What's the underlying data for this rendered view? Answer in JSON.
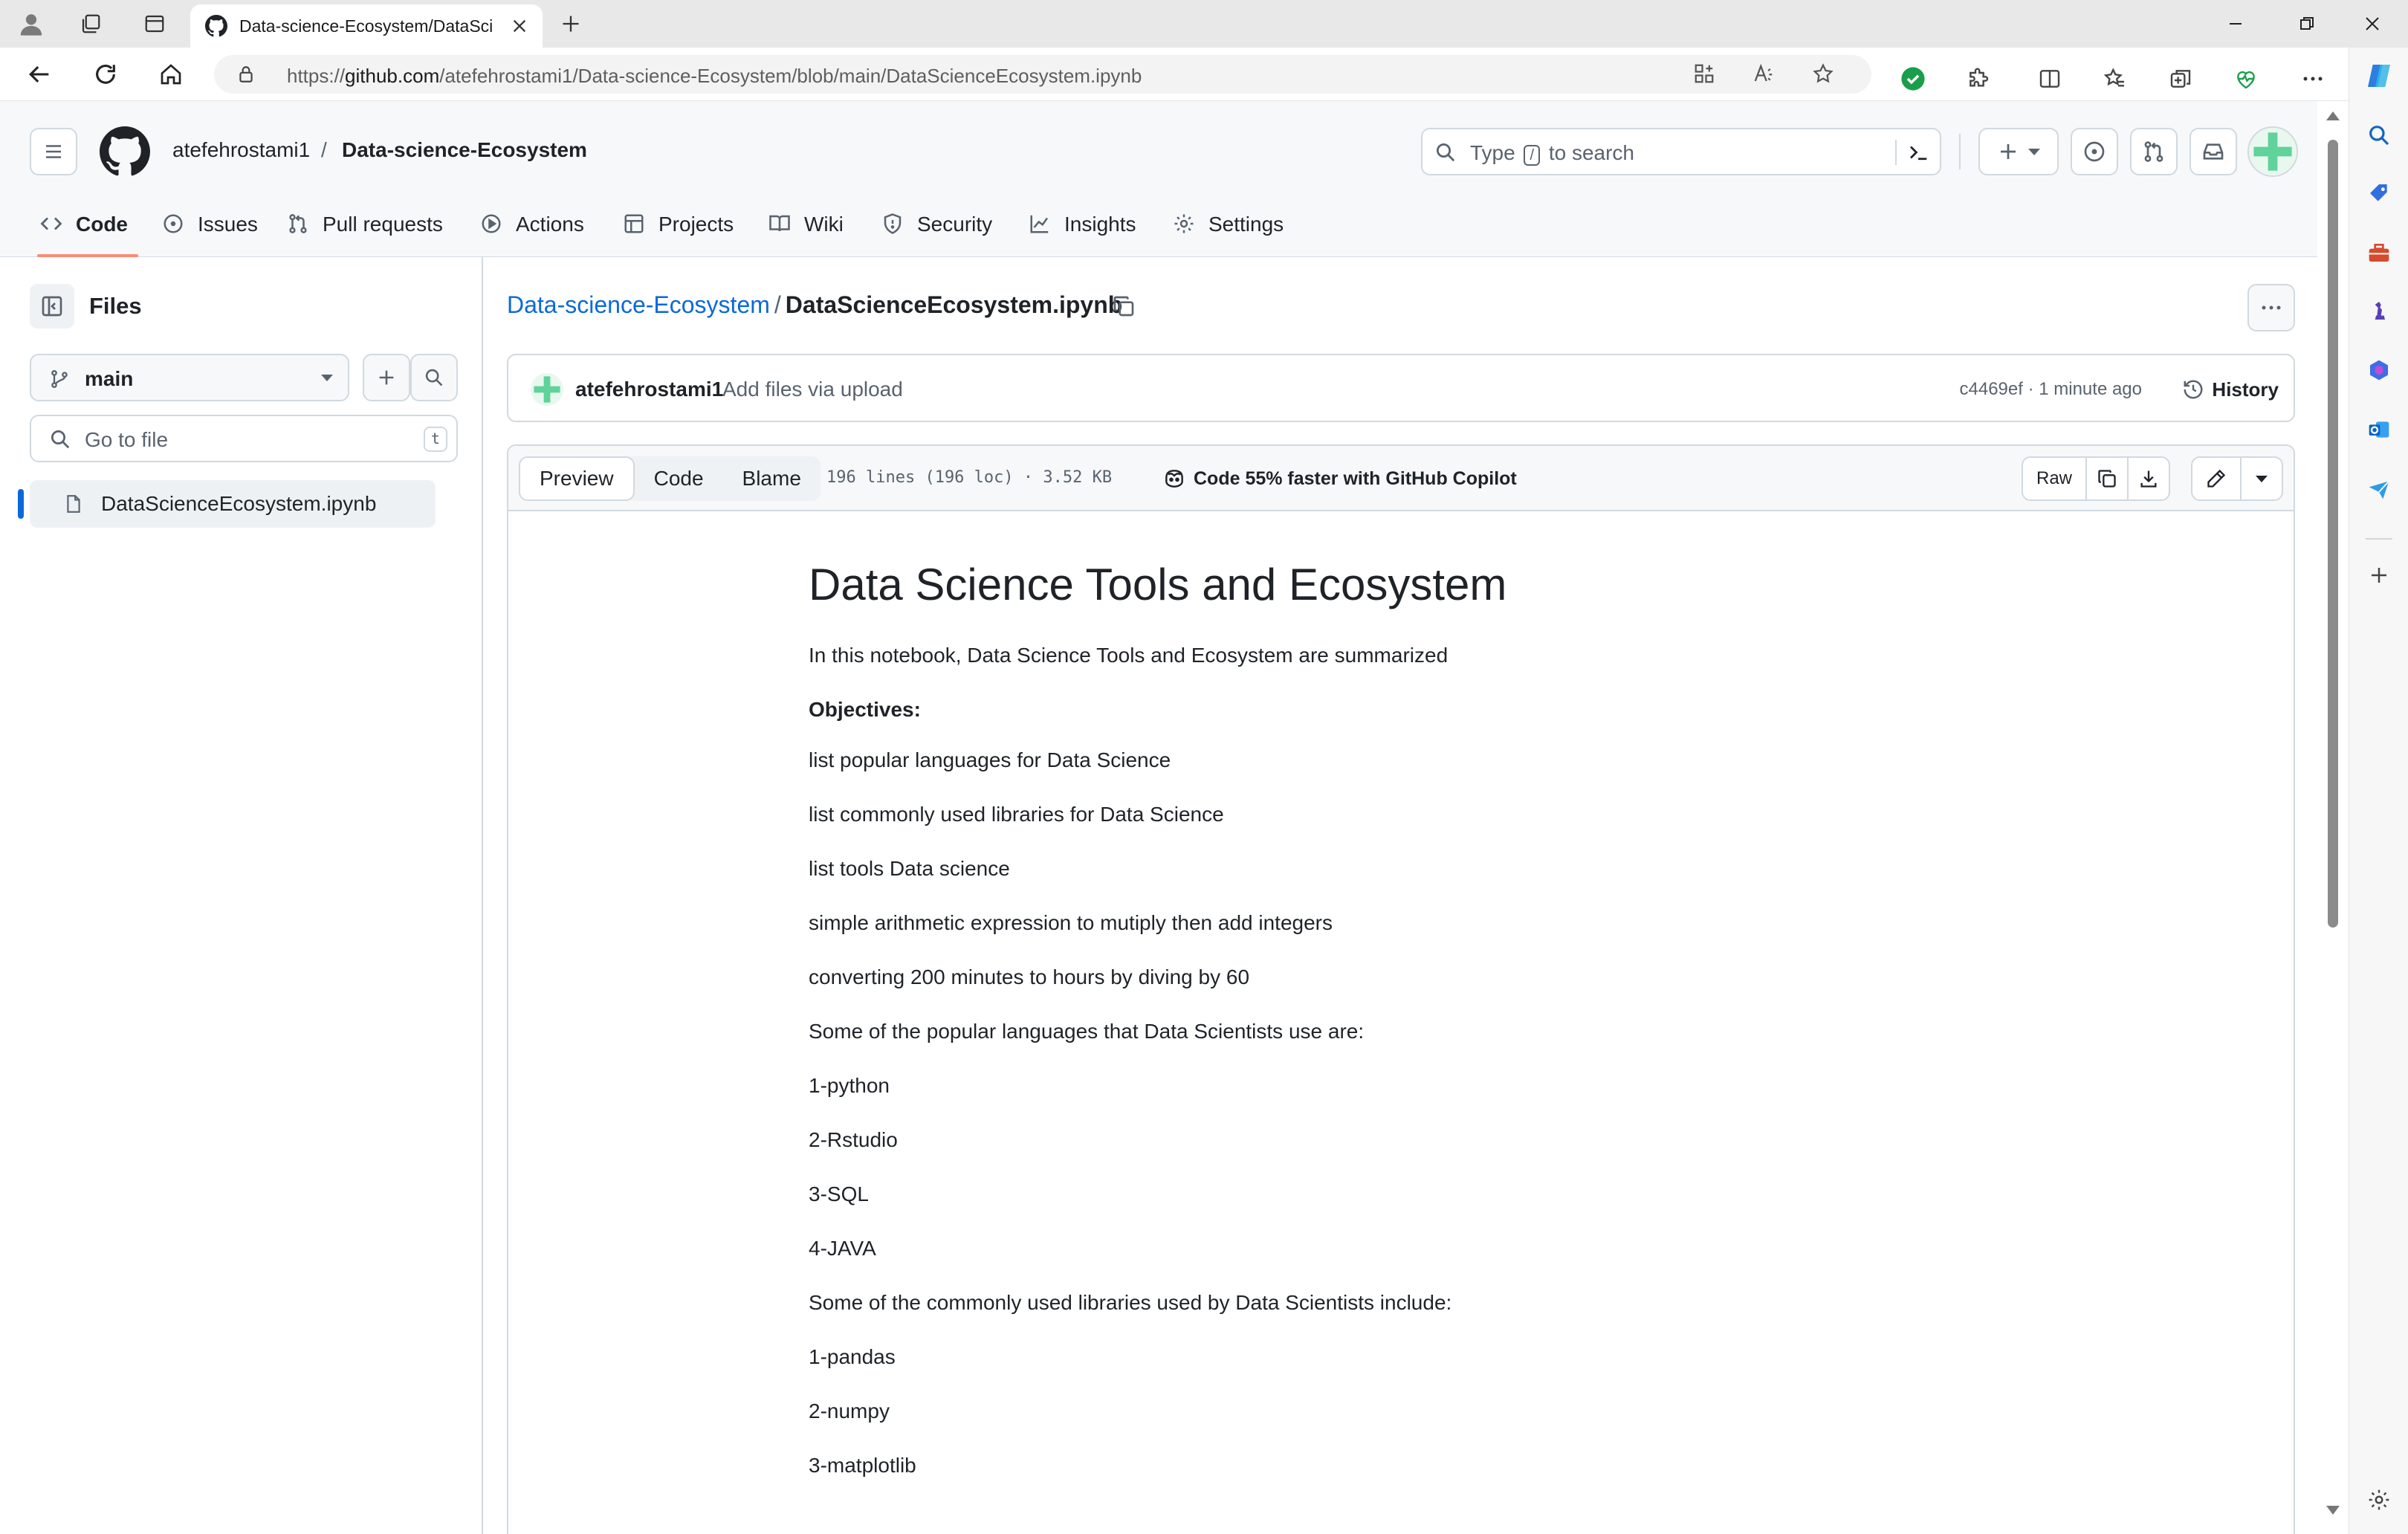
{
  "browser": {
    "tab_title": "Data-science-Ecosystem/DataSci",
    "url_prefix": "https://",
    "url_host": "github.com",
    "url_path": "/atefehrostami1/Data-science-Ecosystem/blob/main/DataScienceEcosystem.ipynb"
  },
  "header": {
    "owner": "atefehrostami1",
    "separator": "/",
    "repo": "Data-science-Ecosystem",
    "search_prefix": "Type",
    "search_key": "/",
    "search_suffix": "to search"
  },
  "repo_nav": [
    {
      "label": "Code",
      "icon": "code-icon"
    },
    {
      "label": "Issues",
      "icon": "issue-icon"
    },
    {
      "label": "Pull requests",
      "icon": "pull-request-icon"
    },
    {
      "label": "Actions",
      "icon": "play-icon"
    },
    {
      "label": "Projects",
      "icon": "table-icon"
    },
    {
      "label": "Wiki",
      "icon": "book-icon"
    },
    {
      "label": "Security",
      "icon": "shield-icon"
    },
    {
      "label": "Insights",
      "icon": "graph-icon"
    },
    {
      "label": "Settings",
      "icon": "gear-icon"
    }
  ],
  "file_tree": {
    "title": "Files",
    "branch": "main",
    "goto_placeholder": "Go to file",
    "goto_key": "t",
    "items": [
      {
        "name": "DataScienceEcosystem.ipynb",
        "selected": true
      }
    ]
  },
  "file": {
    "repo_link": "Data-science-Ecosystem",
    "separator": "/",
    "name": "DataScienceEcosystem.ipynb",
    "commit_author": "atefehrostami1",
    "commit_message": "Add files via upload",
    "commit_meta": "c4469ef · 1 minute ago",
    "history_label": "History",
    "tabs": [
      "Preview",
      "Code",
      "Blame"
    ],
    "active_tab": "Preview",
    "stats": "196 lines (196 loc) · 3.52 KB",
    "copilot_promo": "Code 55% faster with GitHub Copilot",
    "raw_label": "Raw"
  },
  "notebook": {
    "title": "Data Science Tools and Ecosystem",
    "paragraphs": [
      "In this notebook, Data Science Tools and Ecosystem are summarized",
      "Objectives:",
      "list popular languages for Data Science",
      "list commonly used libraries for Data Science",
      "list tools Data science",
      "simple arithmetic expression to mutiply then add integers",
      "converting 200 minutes to hours by diving by 60",
      "Some of the popular languages that Data Scientists use are:",
      "1-python",
      "2-Rstudio",
      "3-SQL",
      "4-JAVA",
      "Some of the commonly used libraries used by Data Scientists include:",
      "1-pandas",
      "2-numpy",
      "3-matplotlib"
    ]
  },
  "colors": {
    "link": "#0969da",
    "tab_underline": "#fd8c73",
    "border": "#d1d9e0",
    "muted": "#59636e"
  }
}
